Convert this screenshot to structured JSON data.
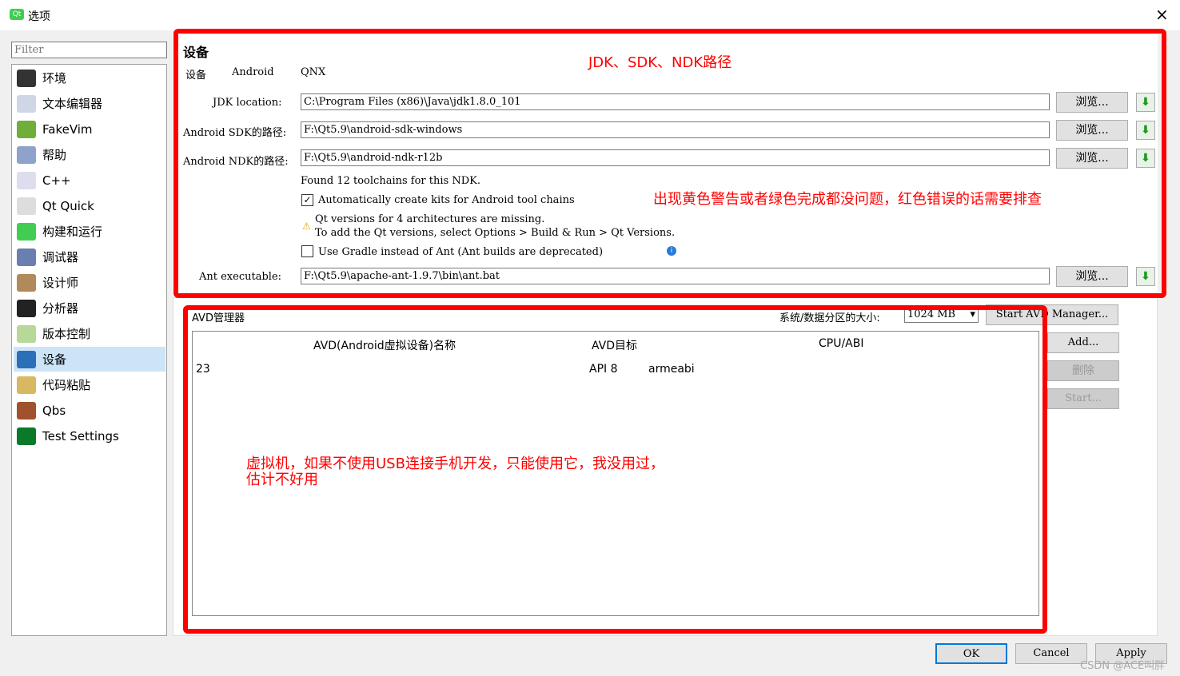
{
  "window": {
    "title": "选项",
    "close": "×"
  },
  "sidebar": {
    "filter_placeholder": "Filter",
    "items": [
      {
        "label": "环境",
        "icon": "monitor-icon",
        "color": "#333"
      },
      {
        "label": "文本编辑器",
        "icon": "text-editor-icon",
        "color": "#cfd6e6"
      },
      {
        "label": "FakeVim",
        "icon": "fakevim-icon",
        "color": "#6fae3a"
      },
      {
        "label": "帮助",
        "icon": "help-icon",
        "color": "#8fa2cc"
      },
      {
        "label": "C++",
        "icon": "cpp-braces-icon",
        "color": "#dde"
      },
      {
        "label": "Qt Quick",
        "icon": "paper-plane-icon",
        "color": "#ddd"
      },
      {
        "label": "构建和运行",
        "icon": "build-run-icon",
        "color": "#41cd52"
      },
      {
        "label": "调试器",
        "icon": "bug-icon",
        "color": "#6a7fb0"
      },
      {
        "label": "设计师",
        "icon": "designer-icon",
        "color": "#b08a5a"
      },
      {
        "label": "分析器",
        "icon": "analyzer-icon",
        "color": "#222"
      },
      {
        "label": "版本控制",
        "icon": "version-control-icon",
        "color": "#b8d89a"
      },
      {
        "label": "设备",
        "icon": "device-icon",
        "color": "#2a6fb8"
      },
      {
        "label": "代码粘贴",
        "icon": "code-paste-icon",
        "color": "#d8b860"
      },
      {
        "label": "Qbs",
        "icon": "hammer-icon",
        "color": "#a0522d"
      },
      {
        "label": "Test Settings",
        "icon": "qa-icon",
        "color": "#0a7a2a"
      }
    ],
    "selected": "设备"
  },
  "main": {
    "title": "设备",
    "tabs": [
      "设备",
      "Android",
      "QNX"
    ],
    "jdk_label": "JDK location:",
    "jdk_value": "C:\\Program Files (x86)\\Java\\jdk1.8.0_101",
    "sdk_label": "Android SDK的路径:",
    "sdk_value": "F:\\Qt5.9\\android-sdk-windows",
    "ndk_label": "Android NDK的路径:",
    "ndk_value": "F:\\Qt5.9\\android-ndk-r12b",
    "browse": "浏览...",
    "found": "Found 12 toolchains for this NDK.",
    "auto_kits": "Automatically create kits for Android tool chains",
    "auto_kits_checked": true,
    "warn1": "Qt versions for 4 architectures are missing.",
    "warn2": "To add the Qt versions, select Options > Build & Run > Qt Versions.",
    "gradle": "Use Gradle instead of Ant (Ant builds are deprecated)",
    "gradle_checked": false,
    "ant_label": "Ant executable:",
    "ant_value": "F:\\Qt5.9\\apache-ant-1.9.7\\bin\\ant.bat"
  },
  "avd": {
    "title": "AVD管理器",
    "partition_label": "系统/数据分区的大小:",
    "partition_value": "1024 MB",
    "start_manager": "Start AVD Manager...",
    "add": "Add...",
    "delete": "删除",
    "start": "Start...",
    "columns": [
      "AVD(Android虚拟设备)名称",
      "AVD目标",
      "CPU/ABI"
    ],
    "rows": [
      {
        "name": "23",
        "target": "API 8",
        "abi": "armeabi"
      }
    ]
  },
  "annotations": {
    "a1": "JDK、SDK、NDK路径",
    "a2": "出现黄色警告或者绿色完成都没问题，红色错误的话需要排查",
    "a3": "虚拟机，如果不使用USB连接手机开发，只能使用它，我没用过，",
    "a4": "估计不好用"
  },
  "footer": {
    "ok": "OK",
    "cancel": "Cancel",
    "apply": "Apply",
    "watermark": "CSDN @ACE叫胖"
  }
}
